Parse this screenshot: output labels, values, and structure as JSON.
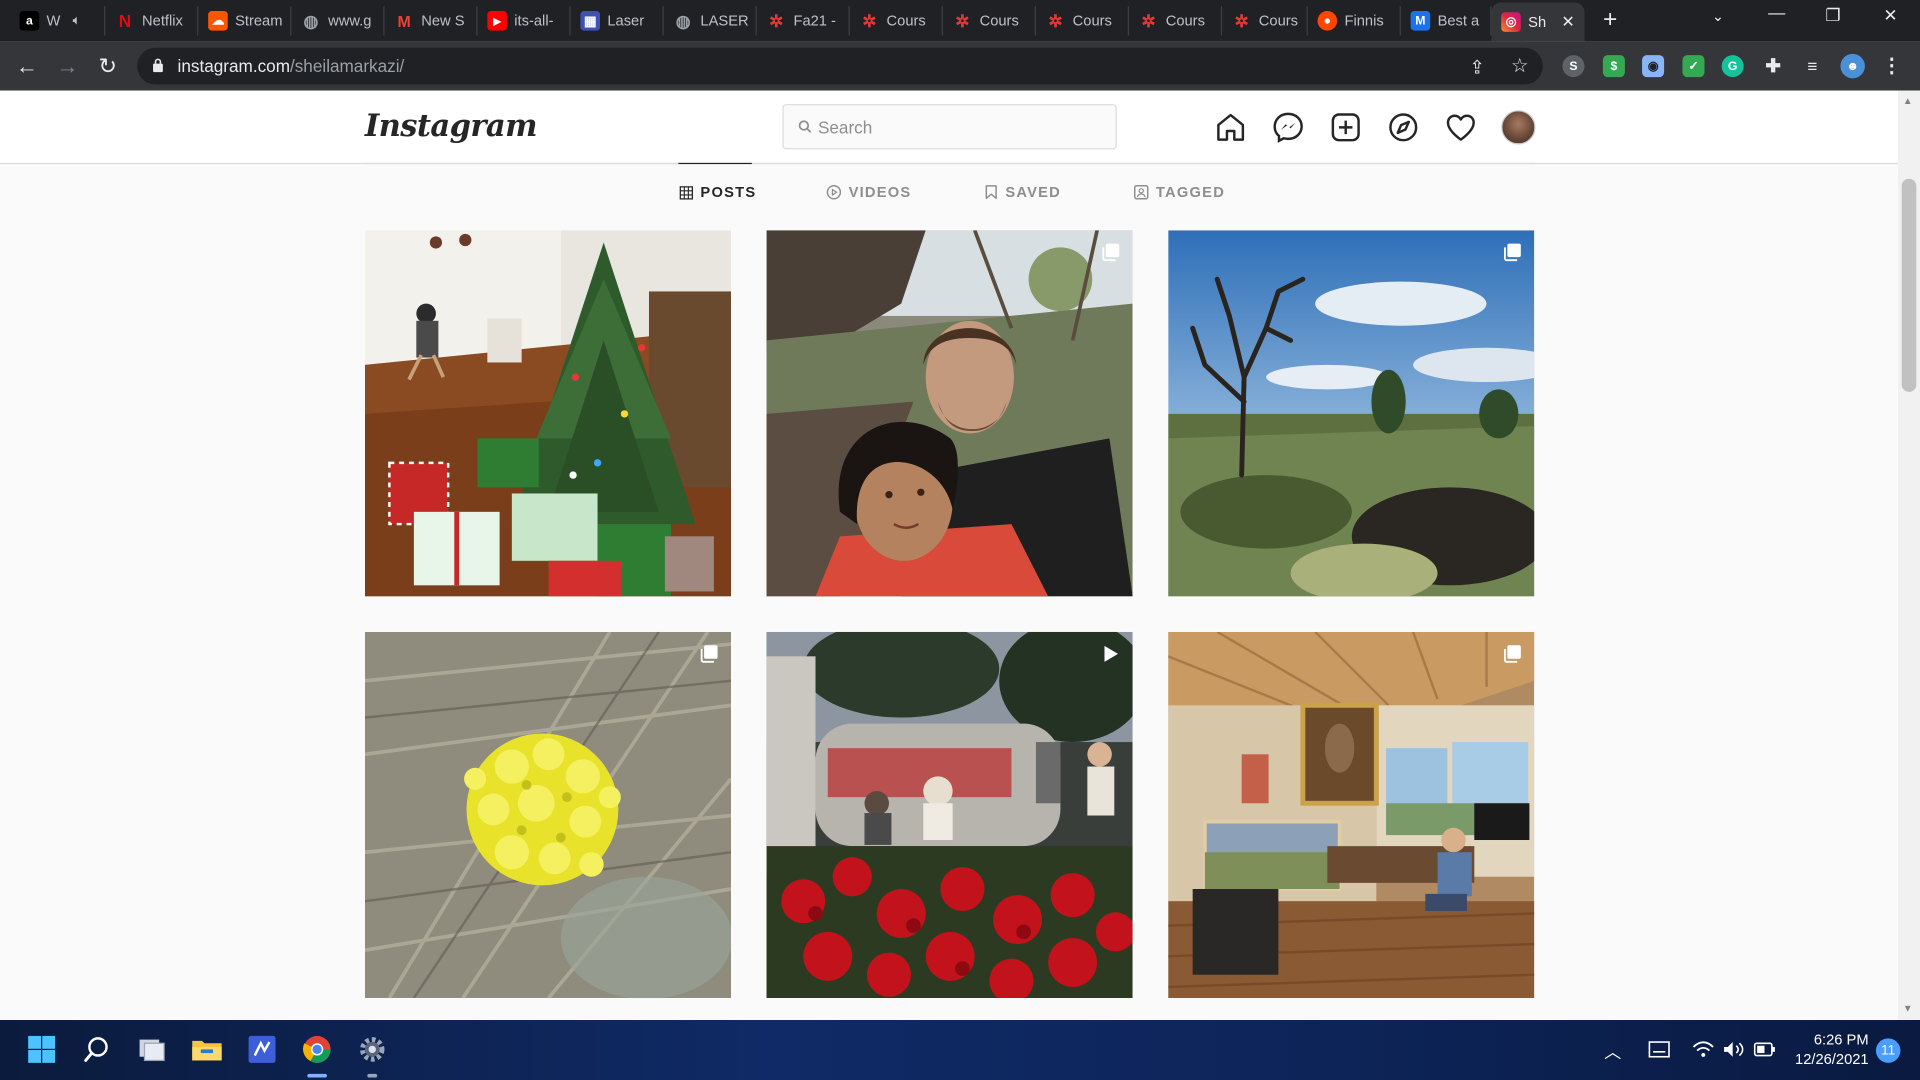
{
  "browser": {
    "tabs": [
      {
        "title": "W",
        "favicon": "amazon-icon",
        "color": "#000000",
        "glyph": "a",
        "muted": true
      },
      {
        "title": "Netflix",
        "favicon": "netflix-icon",
        "color": "#e50914",
        "glyph": "N"
      },
      {
        "title": "Stream",
        "favicon": "soundcloud-icon",
        "color": "#ff5500",
        "glyph": "☁"
      },
      {
        "title": "www.g",
        "favicon": "globe-icon",
        "color": "#5f6368",
        "glyph": "◍"
      },
      {
        "title": "New S",
        "favicon": "gmail-icon",
        "color": "#d93025",
        "glyph": "M"
      },
      {
        "title": "its-all-",
        "favicon": "youtube-icon",
        "color": "#ff0000",
        "glyph": "▶"
      },
      {
        "title": "Laser",
        "favicon": "trello-icon",
        "color": "#3f51b5",
        "glyph": "▦"
      },
      {
        "title": "LASER",
        "favicon": "globe-icon",
        "color": "#5f6368",
        "glyph": "◍"
      },
      {
        "title": "Fa21 -",
        "favicon": "canvas-icon",
        "color": "#c62828",
        "glyph": "✲"
      },
      {
        "title": "Cours",
        "favicon": "canvas-icon",
        "color": "#c62828",
        "glyph": "✲"
      },
      {
        "title": "Cours",
        "favicon": "canvas-icon",
        "color": "#c62828",
        "glyph": "✲"
      },
      {
        "title": "Cours",
        "favicon": "canvas-icon",
        "color": "#c62828",
        "glyph": "✲"
      },
      {
        "title": "Cours",
        "favicon": "canvas-icon",
        "color": "#c62828",
        "glyph": "✲"
      },
      {
        "title": "Cours",
        "favicon": "canvas-icon",
        "color": "#c62828",
        "glyph": "✲"
      },
      {
        "title": "Finnis",
        "favicon": "reddit-icon",
        "color": "#ff4500",
        "glyph": "●"
      },
      {
        "title": "Best a",
        "favicon": "medium-icon",
        "color": "#1a73e8",
        "glyph": "M"
      },
      {
        "title": "Sh",
        "favicon": "instagram-icon",
        "color": "#c13584",
        "glyph": "◎",
        "active": true
      }
    ],
    "url": "instagram.com/sheilamarkazi/",
    "url_host": "instagram.com",
    "url_path": "/sheilamarkazi/"
  },
  "instagram": {
    "logo": "Instagram",
    "search_placeholder": "Search",
    "nav_icons": [
      "home-icon",
      "messenger-icon",
      "new-post-icon",
      "explore-icon",
      "activity-heart-icon",
      "profile-avatar"
    ],
    "tabs": [
      {
        "label": "POSTS",
        "icon": "grid-icon",
        "active": true
      },
      {
        "label": "VIDEOS",
        "icon": "play-circle-icon"
      },
      {
        "label": "SAVED",
        "icon": "bookmark-icon"
      },
      {
        "label": "TAGGED",
        "icon": "tag-user-icon"
      }
    ],
    "posts": [
      {
        "subject": "christmas-tree-with-gifts",
        "badge": "none"
      },
      {
        "subject": "couple-selfie-in-lava-field",
        "badge": "carousel"
      },
      {
        "subject": "dead-tree-blue-sky-landscape",
        "badge": "carousel"
      },
      {
        "subject": "yellow-wildflower-closeup",
        "badge": "carousel"
      },
      {
        "subject": "airstream-trailer-red-flowers",
        "badge": "video"
      },
      {
        "subject": "painter-studio-interior",
        "badge": "carousel"
      }
    ]
  },
  "taskbar": {
    "apps": [
      "windows-start-icon",
      "search-icon",
      "task-view-icon",
      "file-explorer-icon",
      "visual-studio-icon",
      "chrome-icon",
      "settings-icon"
    ],
    "time": "6:26 PM",
    "date": "12/26/2021",
    "notifications": "11"
  }
}
